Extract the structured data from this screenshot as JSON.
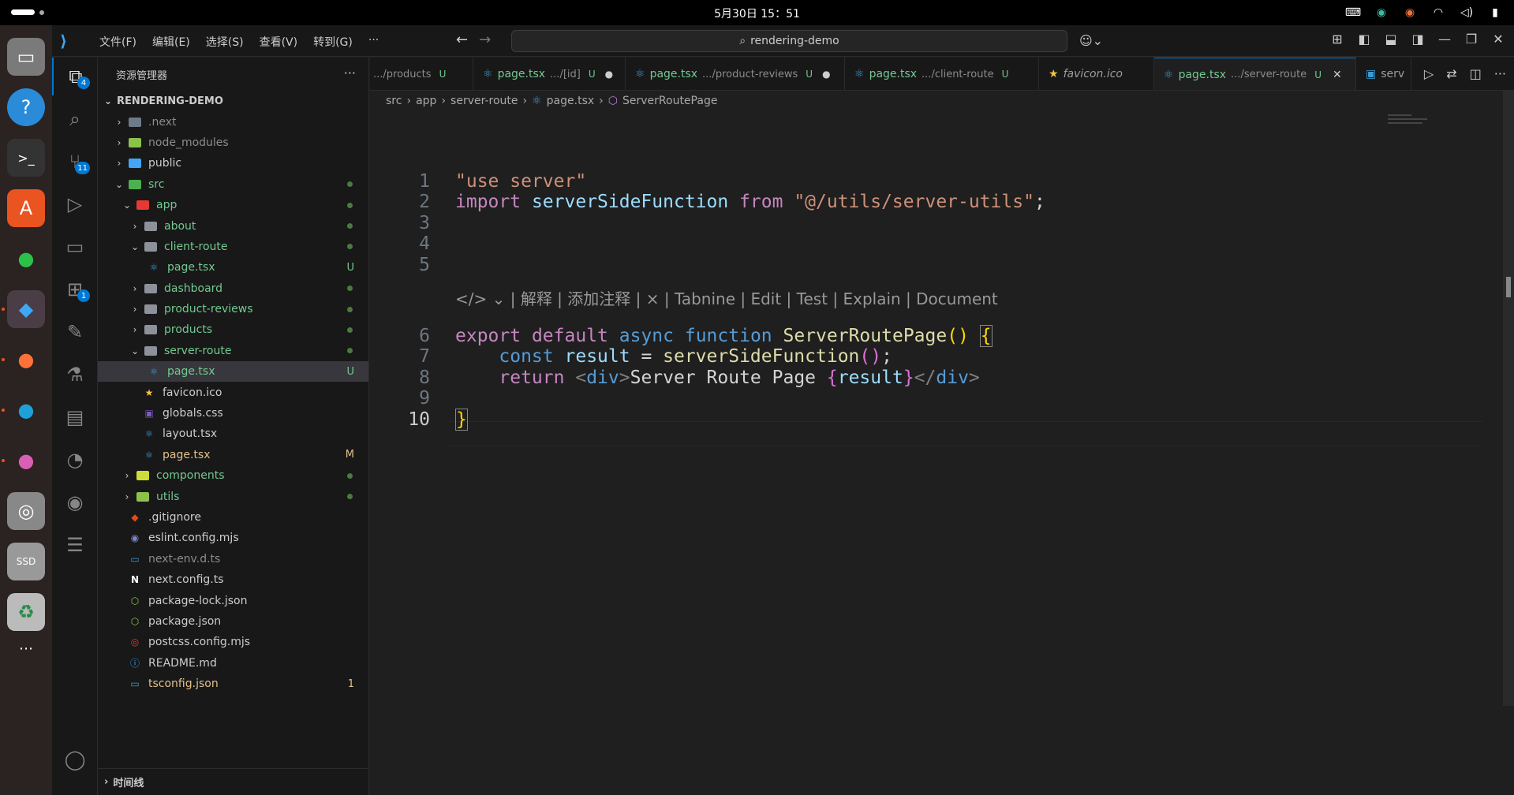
{
  "topbar": {
    "clock": "5月30日 15：51"
  },
  "window": {
    "search": "rendering-demo",
    "menus": [
      "文件(F)",
      "编辑(E)",
      "选择(S)",
      "查看(V)",
      "转到(G)",
      "···"
    ]
  },
  "activity": {
    "explorer_badge": "4",
    "scm_badge": "11",
    "extensions_badge": "1"
  },
  "explorer": {
    "title": "资源管理器",
    "root": "RENDERING-DEMO",
    "items": [
      {
        "label": ".next",
        "status": ""
      },
      {
        "label": "node_modules",
        "status": ""
      },
      {
        "label": "public",
        "status": ""
      },
      {
        "label": "src",
        "status": "dot"
      },
      {
        "label": "app",
        "status": "dot"
      },
      {
        "label": "about",
        "status": "dot"
      },
      {
        "label": "client-route",
        "status": "dot"
      },
      {
        "label": "page.tsx",
        "status": "U"
      },
      {
        "label": "dashboard",
        "status": "dot"
      },
      {
        "label": "product-reviews",
        "status": "dot"
      },
      {
        "label": "products",
        "status": "dot"
      },
      {
        "label": "server-route",
        "status": "dot"
      },
      {
        "label": "page.tsx",
        "status": "U"
      },
      {
        "label": "favicon.ico",
        "status": ""
      },
      {
        "label": "globals.css",
        "status": ""
      },
      {
        "label": "layout.tsx",
        "status": ""
      },
      {
        "label": "page.tsx",
        "status": "M"
      },
      {
        "label": "components",
        "status": "dot"
      },
      {
        "label": "utils",
        "status": "dot"
      },
      {
        "label": ".gitignore",
        "status": ""
      },
      {
        "label": "eslint.config.mjs",
        "status": ""
      },
      {
        "label": "next-env.d.ts",
        "status": ""
      },
      {
        "label": "next.config.ts",
        "status": ""
      },
      {
        "label": "package-lock.json",
        "status": ""
      },
      {
        "label": "package.json",
        "status": ""
      },
      {
        "label": "postcss.config.mjs",
        "status": ""
      },
      {
        "label": "README.md",
        "status": ""
      },
      {
        "label": "tsconfig.json",
        "status": "1"
      }
    ],
    "timeline": "时间线"
  },
  "tabs": [
    {
      "name": "",
      "desc": ".../products",
      "flag": "U"
    },
    {
      "name": "page.tsx",
      "desc": ".../[id]",
      "flag": "U"
    },
    {
      "name": "page.tsx",
      "desc": ".../product-reviews",
      "flag": "U"
    },
    {
      "name": "page.tsx",
      "desc": ".../client-route",
      "flag": "U"
    },
    {
      "name": "favicon.ico",
      "desc": "",
      "flag": ""
    },
    {
      "name": "page.tsx",
      "desc": ".../server-route",
      "flag": "U"
    },
    {
      "name": "serv",
      "desc": "",
      "flag": ""
    }
  ],
  "breadcrumb": [
    "src",
    "app",
    "server-route",
    "page.tsx",
    "ServerRoutePage"
  ],
  "code": {
    "line_numbers": [
      "1",
      "2",
      "3",
      "4",
      "5",
      "6",
      "7",
      "8",
      "9",
      "10"
    ],
    "l1": "\"use server\"",
    "l2_import": "import",
    "l2_name": "serverSideFunction",
    "l2_from": "from",
    "l2_path": "\"@/utils/server-utils\"",
    "l2_semi": ";",
    "codelens": "</> ⌄ | 解释 | 添加注释 | × | Tabnine | Edit | Test | Explain | Document",
    "l6_export": "export",
    "l6_default": "default",
    "l6_async": "async",
    "l6_function": "function",
    "l6_name": "ServerRoutePage",
    "l6_parens": "()",
    "l6_brace": "{",
    "l7_const": "const",
    "l7_var": "result",
    "l7_eq": " = ",
    "l7_call": "serverSideFunction",
    "l7_parens": "()",
    "l7_semi": ";",
    "l8_return": "return",
    "l8_open": "<",
    "l8_tag": "div",
    "l8_close": ">",
    "l8_text": "Server Route Page ",
    "l8_bopen": "{",
    "l8_expr": "result",
    "l8_bclose": "}",
    "l8_endopen": "</",
    "l8_endtag": "div",
    "l8_endclose": ">",
    "l10": "}"
  }
}
